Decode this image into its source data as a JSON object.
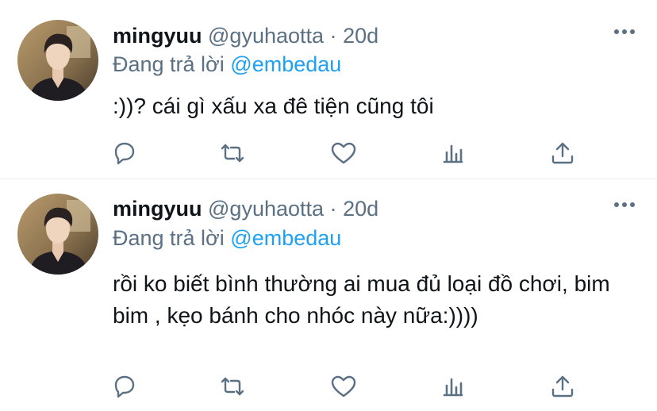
{
  "tweets": [
    {
      "name": "mingyuu",
      "handle": "@gyuhaotta",
      "separator": "·",
      "time": "20d",
      "replying_prefix": "Đang trả lời",
      "replying_to": "@embedau",
      "text": ":))? cái gì xấu xa đê tiện cũng tôi"
    },
    {
      "name": "mingyuu",
      "handle": "@gyuhaotta",
      "separator": "·",
      "time": "20d",
      "replying_prefix": "Đang trả lời",
      "replying_to": "@embedau",
      "text": "rồi ko biết bình thường ai mua đủ loại đồ chơi, bim bim , kẹo bánh cho nhóc này nữa:))))"
    }
  ],
  "icons": [
    "reply-icon",
    "retweet-icon",
    "like-icon",
    "analytics-icon",
    "share-icon",
    "more-icon"
  ],
  "colors": {
    "text": "#0f1419",
    "secondary": "#5b7083",
    "accent": "#1da1f2",
    "divider": "#e6ecf0"
  }
}
